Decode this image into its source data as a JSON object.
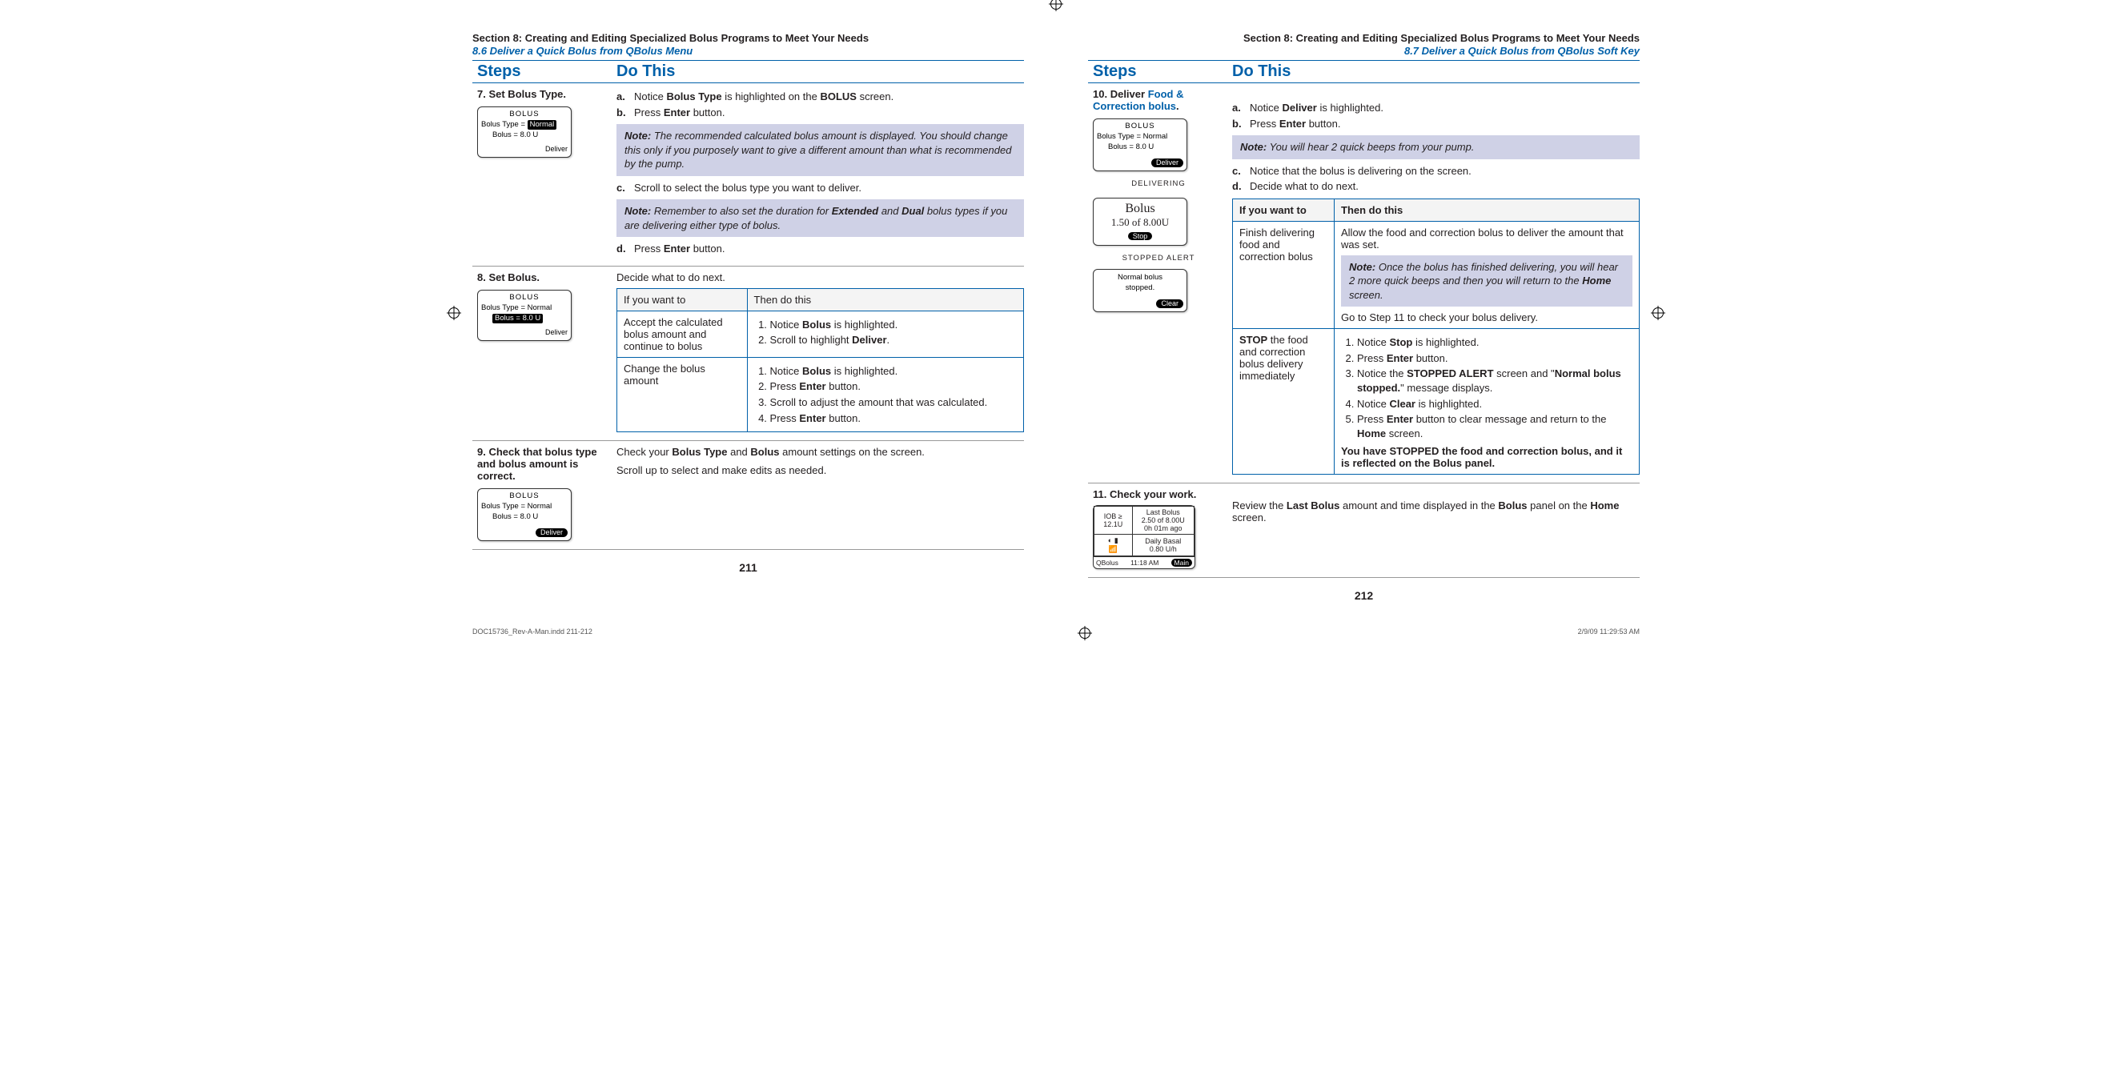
{
  "left": {
    "section_title": "Section 8: Creating and Editing Specialized Bolus Programs to Meet Your Needs",
    "subsection": "8.6 Deliver a Quick Bolus from QBolus Menu",
    "header_steps": "Steps",
    "header_do": "Do This",
    "step7": {
      "num": "7.",
      "title": "Set Bolus Type.",
      "a_html": "Notice <b>Bolus Type</b> is highlighted on the <b>BOLUS</b> screen.",
      "b_html": "Press <b>Enter</b> button.",
      "note1_html": "The recommended calculated bolus amount is displayed. You should change this only if you purposely want to give a different amount than what is recommended by the pump.",
      "c_html": "Scroll to select the bolus type you want to deliver.",
      "note2_html": "Remember to also set the duration for <b>Extended</b> and <b>Dual</b> bolus types if you are delivering either type of bolus.",
      "d_html": "Press <b>Enter</b> button.",
      "screen": {
        "title": "BOLUS",
        "line1_pre": "Bolus Type =",
        "line1_hl": "Normal",
        "line2": "Bolus = 8.0 U",
        "footer": "Deliver"
      }
    },
    "step8": {
      "num": "8.",
      "title": "Set Bolus.",
      "intro": "Decide what to do next.",
      "th1": "If you want to",
      "th2": "Then do this",
      "row1_left": "Accept the calculated bolus amount and continue to bolus",
      "row1_li1": "Notice <b>Bolus</b> is highlighted.",
      "row1_li2": "Scroll to highlight <b>Deliver</b>.",
      "row2_left": "Change the bolus amount",
      "row2_li1": "Notice <b>Bolus</b> is highlighted.",
      "row2_li2": "Press <b>Enter</b> button.",
      "row2_li3": "Scroll to adjust the amount that was calculated.",
      "row2_li4": "Press <b>Enter</b> button.",
      "screen": {
        "title": "BOLUS",
        "line1": "Bolus Type = Normal",
        "line2_hl": "Bolus = 8.0 U",
        "footer": "Deliver"
      }
    },
    "step9": {
      "num": "9.",
      "title": "Check that bolus type and bolus amount is correct.",
      "p1_html": "Check your <b>Bolus Type</b> and <b>Bolus</b> amount settings on the screen.",
      "p2": "Scroll up to select and make edits as needed.",
      "screen": {
        "title": "BOLUS",
        "line1": "Bolus Type = Normal",
        "line2": "Bolus = 8.0 U",
        "footer_btn": "Deliver"
      }
    },
    "page_num": "211"
  },
  "right": {
    "section_title": "Section 8: Creating and Editing Specialized Bolus Programs to Meet Your Needs",
    "subsection": "8.7 Deliver a Quick Bolus from QBolus Soft Key",
    "header_steps": "Steps",
    "header_do": "Do This",
    "step10": {
      "num": "10.",
      "title_pre": "Deliver ",
      "title_link": "Food & Correction bolus",
      "title_post": ".",
      "a_html": "Notice <b>Deliver</b> is highlighted.",
      "b_html": "Press <b>Enter</b> button.",
      "note1": "You will hear 2 quick beeps from your pump.",
      "c_html": "Notice that the bolus is delivering on the screen.",
      "d_html": "Decide what to do next.",
      "th1": "If you want to",
      "th2": "Then do this",
      "row1_left": "Finish delivering food and correction bolus",
      "row1_p1": "Allow the food and correction bolus to deliver the amount that was set.",
      "row1_note_html": "Once the bolus has finished delivering, you will hear 2 more quick beeps and then you will return to the <b>Home</b> screen.",
      "row1_p2": "Go to Step 11 to check your bolus delivery.",
      "row2_left_html": "<b>STOP</b> the food and correction bolus delivery immediately",
      "row2_li1": "Notice <b>Stop</b> is highlighted.",
      "row2_li2": "Press <b>Enter</b> button.",
      "row2_li3": "Notice the <b>STOPPED ALERT</b> screen and \"<b>Normal bolus stopped.</b>\" message displays.",
      "row2_li4": "Notice <b>Clear</b> is highlighted.",
      "row2_li5": "Press <b>Enter</b> button to clear message and return to the <b>Home</b> screen.",
      "row2_final_html": "<b>You have STOPPED the food and correction bolus, and it is reflected on the Bolus panel.</b>",
      "screen1": {
        "title": "BOLUS",
        "line1": "Bolus Type = Normal",
        "line2": "Bolus = 8.0 U",
        "footer_btn": "Deliver"
      },
      "screen2_title": "DELIVERING",
      "screen2_big1": "Bolus",
      "screen2_big2": "1.50 of 8.00U",
      "screen2_btn": "Stop",
      "screen3_title": "STOPPED ALERT",
      "screen3_l1": "Normal bolus",
      "screen3_l2": "stopped.",
      "screen3_btn": "Clear"
    },
    "step11": {
      "num": "11.",
      "title": "Check your work.",
      "p1_html": "Review the <b>Last Bolus</b> amount and time displayed in the <b>Bolus</b> panel on the <b>Home</b> screen.",
      "home": {
        "iob_lbl": "IOB ≥",
        "iob_val": "12.1U",
        "last_lbl": "Last Bolus",
        "last_val1": "2.50 of 8.00U",
        "last_val2": "0h 01m ago",
        "basal_lbl": "Daily Basal",
        "basal_val": "0.80 U/h",
        "foot_left": "QBolus",
        "foot_mid": "11:18 AM",
        "foot_right": "Main"
      }
    },
    "page_num": "212"
  },
  "print": {
    "left": "DOC15736_Rev-A-Man.indd   211-212",
    "right": "2/9/09   11:29:53 AM"
  },
  "note_label": "Note:"
}
